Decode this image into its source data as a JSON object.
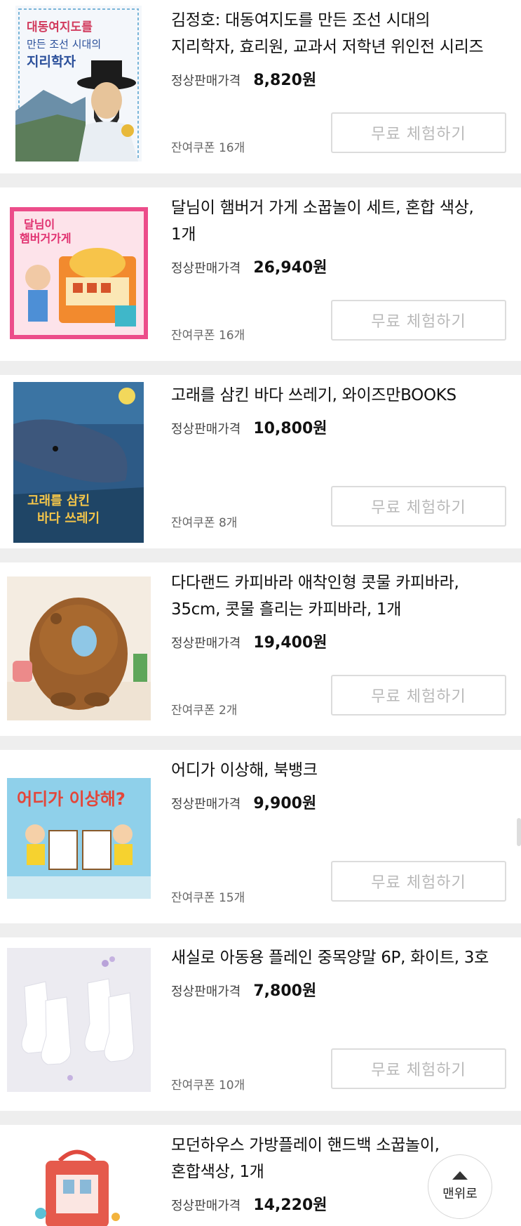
{
  "labels": {
    "price_label": "정상판매가격",
    "try_button": "무료 체험하기",
    "back_to_top": "맨위로"
  },
  "products": [
    {
      "title_line1": "김정호: 대동여지도를 만든 조선 시대의",
      "title_line2": "지리학자, 효리원, 교과서 저학년 위인전 시리즈",
      "price": "8,820원",
      "coupon": "잔여쿠폰 16개",
      "thumb_text": [
        "대동여지도를",
        "만든 조선 시대의",
        "지리학자"
      ]
    },
    {
      "title_line1": "달님이 햄버거 가게 소꿉놀이 세트, 혼합 색상,",
      "title_line2": "1개",
      "price": "26,940원",
      "coupon": "잔여쿠폰 16개",
      "thumb_text": [
        "달님이",
        "햄버거가게"
      ]
    },
    {
      "title_line1": "고래를 삼킨 바다 쓰레기, 와이즈만BOOKS",
      "title_line2": "",
      "price": "10,800원",
      "coupon": "잔여쿠폰 8개",
      "thumb_text": [
        "고래를 삼킨",
        "바다 쓰레기"
      ]
    },
    {
      "title_line1": "다다랜드 카피바라 애착인형 콧물 카피바라,",
      "title_line2": "35cm, 콧물 흘리는 카피바라, 1개",
      "price": "19,400원",
      "coupon": "잔여쿠폰 2개",
      "thumb_text": []
    },
    {
      "title_line1": "어디가 이상해, 북뱅크",
      "title_line2": "",
      "price": "9,900원",
      "coupon": "잔여쿠폰 15개",
      "thumb_text": [
        "어디가 이상해?"
      ]
    },
    {
      "title_line1": "새실로 아동용 플레인 중목양말 6P, 화이트, 3호",
      "title_line2": "",
      "price": "7,800원",
      "coupon": "잔여쿠폰 10개",
      "thumb_text": []
    },
    {
      "title_line1": "모던하우스 가방플레이 핸드백 소꿉놀이,",
      "title_line2": "혼합색상, 1개",
      "price": "14,220원",
      "coupon": "",
      "thumb_text": []
    }
  ]
}
